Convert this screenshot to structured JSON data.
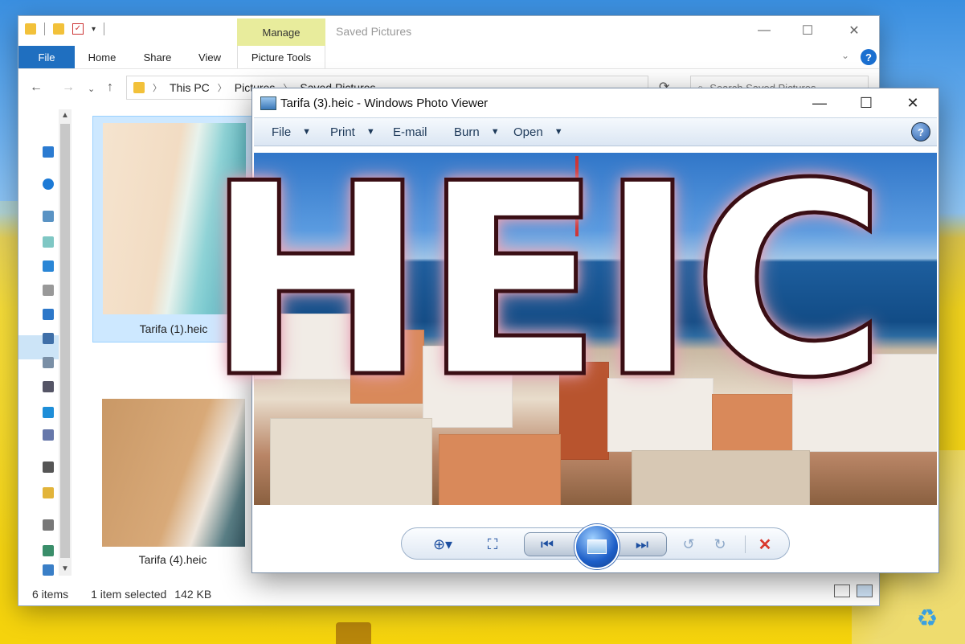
{
  "explorer": {
    "title": "Saved Pictures",
    "contextual_tab": "Manage",
    "ribbon_tabs": [
      "File",
      "Home",
      "Share",
      "View",
      "Picture Tools"
    ],
    "breadcrumb": [
      "This PC",
      "Pictures",
      "Saved Pictures"
    ],
    "search_placeholder": "Search Saved Pictures",
    "files": [
      {
        "name": "Tarifa (1).heic",
        "selected": true
      },
      {
        "name": "Tarifa (4).heic",
        "selected": false
      }
    ],
    "status": {
      "item_count": "6 items",
      "selection": "1 item selected",
      "size": "142 KB"
    }
  },
  "viewer": {
    "title": "Tarifa (3).heic - Windows Photo Viewer",
    "menu": [
      "File",
      "Print",
      "E-mail",
      "Burn",
      "Open"
    ],
    "help_label": "?",
    "toolbar_icons": [
      "zoom-icon",
      "fit-window-icon",
      "previous-icon",
      "slideshow-icon",
      "next-icon",
      "rotate-left-icon",
      "rotate-right-icon",
      "delete-icon"
    ]
  },
  "overlay": {
    "text": "HEIC"
  },
  "colors": {
    "accent": "#1f6fc0",
    "manage_tab": "#e8ec9c",
    "delete": "#d9382e",
    "glow": "#e7a3b6"
  }
}
